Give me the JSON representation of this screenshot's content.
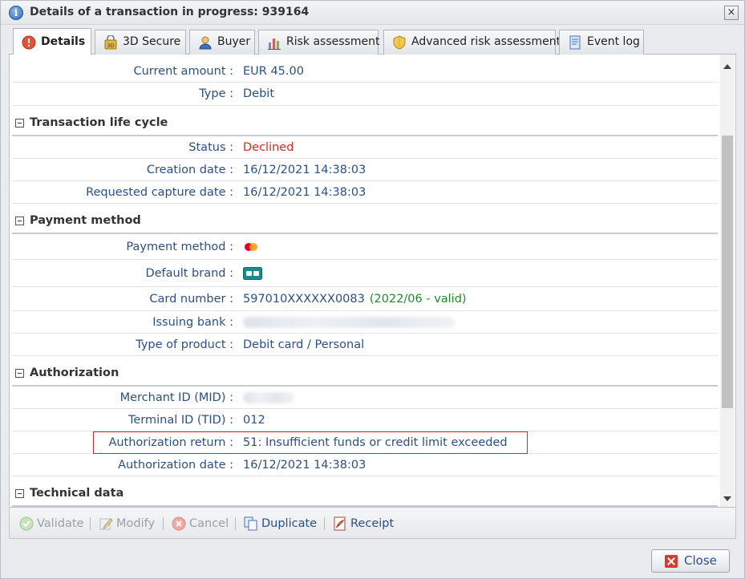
{
  "window": {
    "title": "Details of a transaction in progress: 939164",
    "close_glyph": "×"
  },
  "tabs": [
    {
      "label": "Details",
      "icon": "alert-icon",
      "active": true
    },
    {
      "label": "3D Secure",
      "icon": "3d-secure-icon",
      "active": false
    },
    {
      "label": "Buyer",
      "icon": "user-icon",
      "active": false
    },
    {
      "label": "Risk assessment",
      "icon": "bar-chart-icon",
      "active": false
    },
    {
      "label": "Advanced risk assessment",
      "icon": "shield-icon",
      "active": false
    },
    {
      "label": "Event log",
      "icon": "log-icon",
      "active": false
    }
  ],
  "details": {
    "current_amount": {
      "label": "Current amount :",
      "value": "EUR 45.00"
    },
    "type": {
      "label": "Type :",
      "value": "Debit"
    }
  },
  "lifecycle": {
    "title": "Transaction life cycle",
    "status": {
      "label": "Status :",
      "value": "Declined",
      "color": "#e1261c"
    },
    "creation_date": {
      "label": "Creation date :",
      "value": "16/12/2021 14:38:03"
    },
    "capture_date": {
      "label": "Requested capture date :",
      "value": "16/12/2021 14:38:03"
    }
  },
  "payment": {
    "title": "Payment method",
    "method": {
      "label": "Payment method :",
      "icon": "mastercard-icon"
    },
    "brand": {
      "label": "Default brand :",
      "icon": "cb-card-icon"
    },
    "card_number": {
      "label": "Card number :",
      "value": "597010XXXXXX0083",
      "expiry": "(2022/06 - valid)"
    },
    "issuing_bank": {
      "label": "Issuing bank :"
    },
    "product_type": {
      "label": "Type of product :",
      "value": "Debit card / Personal"
    }
  },
  "authorization": {
    "title": "Authorization",
    "mid": {
      "label": "Merchant ID (MID) :"
    },
    "tid": {
      "label": "Terminal ID (TID) :",
      "value": "012"
    },
    "return": {
      "label": "Authorization return :",
      "value": "51: Insufficient funds or credit limit exceeded"
    },
    "date": {
      "label": "Authorization date :",
      "value": "16/12/2021 14:38:03"
    }
  },
  "technical": {
    "title": "Technical data"
  },
  "toolbar": {
    "validate": "Validate",
    "modify": "Modify",
    "cancel": "Cancel",
    "duplicate": "Duplicate",
    "receipt": "Receipt"
  },
  "footer": {
    "close": "Close"
  },
  "colors": {
    "label_blue": "#2a4f8c",
    "declined_red": "#e1261c",
    "valid_green": "#1f8a28"
  }
}
